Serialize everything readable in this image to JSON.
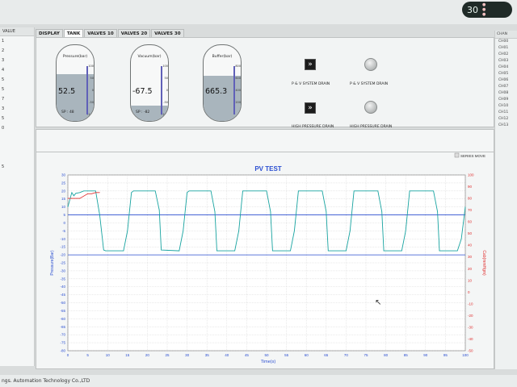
{
  "status": {
    "value": "30",
    "icon": "status-pill-icon"
  },
  "left_panel": {
    "header": "VALUE",
    "rows": [
      "1",
      "2",
      "3",
      "4",
      "5",
      "5",
      "7",
      "3",
      "5",
      "0",
      "",
      "",
      "",
      "5"
    ]
  },
  "right_panel": {
    "header": "CHAN",
    "rows": [
      "CH00",
      "CH01",
      "CH02",
      "CH03",
      "CH04",
      "CH05",
      "CH06",
      "CH07",
      "CH08",
      "CH09",
      "CH10",
      "CH11",
      "CH12",
      "CH13"
    ]
  },
  "tabs": [
    {
      "label": "DISPLAY",
      "active": false
    },
    {
      "label": "TANK",
      "active": true
    },
    {
      "label": "VALVES 10",
      "active": false
    },
    {
      "label": "VALVES 20",
      "active": false
    },
    {
      "label": "VALVES 30",
      "active": false
    }
  ],
  "tanks": [
    {
      "label": "Pressure(bar)",
      "value": "52.5",
      "sp": "SP : 48",
      "scale": [
        "100",
        "50",
        "0",
        "-50",
        "-100"
      ],
      "fill_fraction": 0.62
    },
    {
      "label": "Vacuum(bar)",
      "value": "-67.5",
      "sp": "SP : -82",
      "scale": [
        "100",
        "50",
        "0",
        "-50",
        "-100"
      ],
      "fill_fraction": 0.2
    },
    {
      "label": "Buffer(bar)",
      "value": "665.3",
      "sp": "",
      "scale": [
        "800",
        "600",
        "400",
        "200",
        "0"
      ],
      "fill_fraction": 0.6
    }
  ],
  "drains": [
    {
      "label": "P & V SYSTEM DRAIN",
      "kind": "button"
    },
    {
      "label": "P & V SYSTEM DRAIN",
      "kind": "lamp"
    },
    {
      "label": "HIGH PRESSURE DRAIN",
      "kind": "button"
    },
    {
      "label": "HIGH PRESSURE DRAIN",
      "kind": "lamp"
    }
  ],
  "series_move_label": "SERIES MOVE",
  "footer_text": "ngs. Automation Technology Co.,LTD",
  "colors": {
    "pressure": "#17a3a0",
    "pressure_axis": "#2b4fd1",
    "flow": "#e03030",
    "title": "#2b4fd1"
  },
  "chart_data": {
    "type": "line",
    "title": "PV TEST",
    "xlabel": "Time(s)",
    "ylabel_left": "Pressure(Bar)",
    "ylabel_right": "Cab(mmHgm)",
    "xlim": [
      0,
      100
    ],
    "ylim_left": [
      -80,
      30
    ],
    "ylim_right": [
      -50,
      100
    ],
    "x_ticks": [
      "0",
      "5",
      "10",
      "15",
      "20",
      "25",
      "30",
      "35",
      "40",
      "45",
      "50",
      "55",
      "60",
      "65",
      "70",
      "75",
      "80",
      "85",
      "90",
      "95",
      "100"
    ],
    "y_left_ticks": [
      "30",
      "25",
      "20",
      "15",
      "10",
      "5",
      "0",
      "-5",
      "-10",
      "-15",
      "-20",
      "-25",
      "-30",
      "-35",
      "-40",
      "-45",
      "-50",
      "-55",
      "-60",
      "-65",
      "-70",
      "-75",
      "-80"
    ],
    "y_right_ticks": [
      "100",
      "90",
      "80",
      "70",
      "60",
      "50",
      "40",
      "30",
      "20",
      "10",
      "0",
      "-10",
      "-20",
      "-30",
      "-40",
      "-50"
    ],
    "reference_lines_left": [
      5,
      -20
    ],
    "series": [
      {
        "axis": "left",
        "x": [
          0,
          1,
          1.5,
          2,
          3,
          4,
          5,
          6,
          7,
          8,
          9,
          9.5,
          14,
          15,
          16,
          16.5,
          21,
          22,
          23,
          23.5,
          28,
          29,
          30,
          30.5,
          35,
          36,
          37,
          37.5,
          42,
          43,
          44,
          44.5,
          49,
          50,
          51,
          51.5,
          56,
          57,
          58,
          58.5,
          63,
          64,
          65,
          65.5,
          70,
          71,
          72,
          72.5,
          77,
          78,
          79,
          79.5,
          84,
          85,
          86,
          86.5,
          91,
          92,
          93,
          93.5,
          98,
          99,
          100
        ],
        "y": [
          10,
          19,
          17,
          18.5,
          19,
          20,
          20,
          20,
          20,
          5,
          -17,
          -17.5,
          -17.5,
          -5,
          19,
          20,
          20,
          20,
          8,
          -17,
          -17.5,
          -5,
          19,
          20,
          20,
          20,
          7,
          -17.5,
          -17.5,
          -5,
          20,
          20,
          20,
          20,
          7,
          -17.5,
          -17.5,
          -5,
          20,
          20,
          20,
          20,
          7,
          -17.5,
          -17.5,
          -5,
          20,
          20,
          20,
          20,
          7,
          -17.5,
          -17.5,
          -5,
          20,
          20,
          20,
          20,
          7,
          -17.5,
          -17.5,
          -10,
          10
        ]
      },
      {
        "axis": "right",
        "x": [
          0,
          1,
          3,
          5,
          6,
          7,
          8
        ],
        "y": [
          80,
          80,
          80,
          84,
          84,
          85,
          85
        ]
      }
    ]
  }
}
